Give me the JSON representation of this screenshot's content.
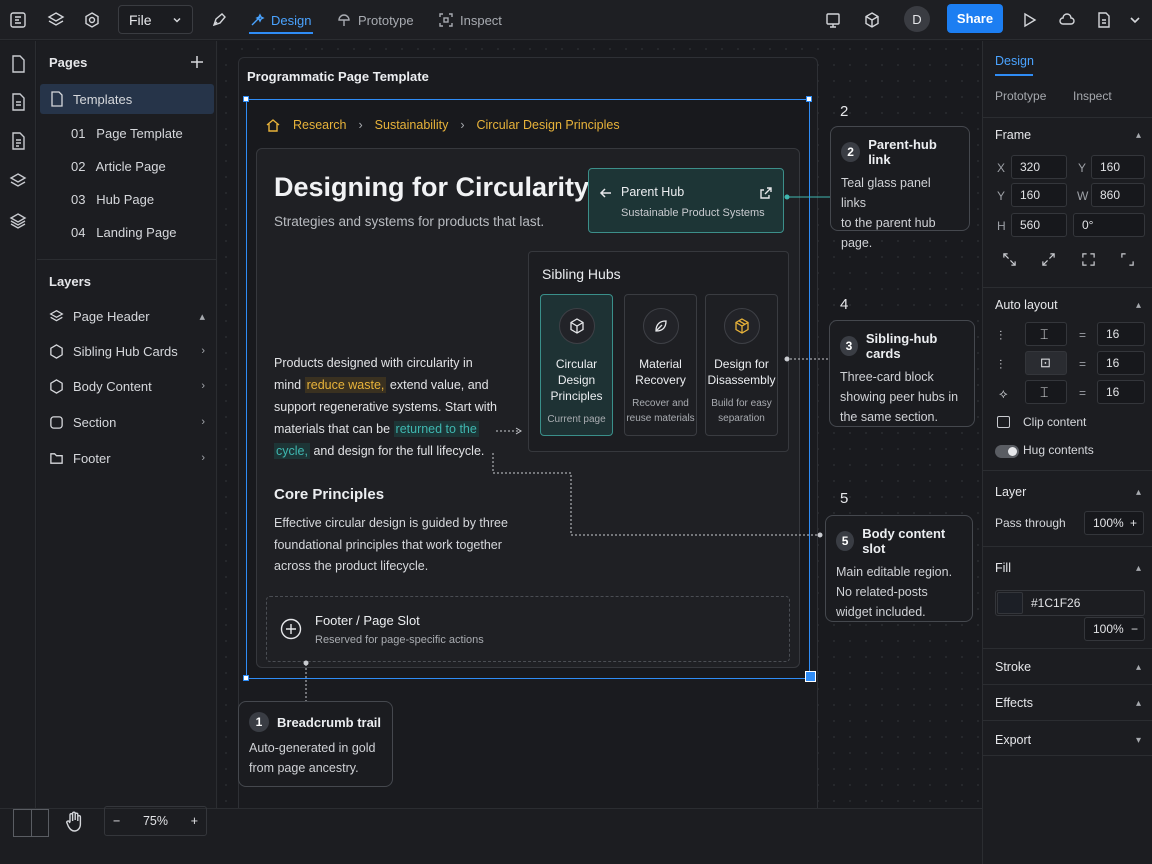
{
  "toolbar": {
    "file_label": "File",
    "tabs": [
      {
        "label": "Design"
      },
      {
        "label": "Prototype"
      },
      {
        "label": "Inspect"
      }
    ],
    "avatar_initial": "D",
    "share_label": "Share"
  },
  "pages": {
    "title": "Pages",
    "items": [
      {
        "label": "Templates"
      },
      {
        "label": "01   Page Template"
      },
      {
        "label": "02   Article Page"
      },
      {
        "label": "03   Hub Page"
      },
      {
        "label": "04   Landing Page"
      }
    ]
  },
  "layers": {
    "title": "Layers",
    "items": [
      {
        "label": "Page Header"
      },
      {
        "label": "Sibling Hub Cards"
      },
      {
        "label": "Body Content"
      },
      {
        "label": "Section"
      },
      {
        "label": "Footer"
      }
    ]
  },
  "zoom": {
    "value": "75%"
  },
  "frame": {
    "title": "Programmatic Page Template",
    "breadcrumb": [
      "Research",
      "Sustainability",
      "Circular Design Principles"
    ],
    "heading": "Designing for Circularity",
    "subheading": "Strategies and systems for products that last.",
    "parent_hub": {
      "label": "Parent Hub",
      "sub": "Sustainable Product Systems"
    },
    "sibling_title": "Sibling Hubs",
    "hubs": [
      {
        "title": "Circular Design Principles",
        "sub": "Current page",
        "icon": "cube-icon"
      },
      {
        "title": "Material Recovery",
        "sub": "Recover and reuse materials",
        "icon": "leaf-icon"
      },
      {
        "title": "Design for Disassembly",
        "sub": "Build for easy separation",
        "icon": "box-icon"
      }
    ],
    "body": {
      "p1": "Products designed with circularity in",
      "p2": "mind",
      "hl1": "reduce waste,",
      "p3": "extend value, and",
      "p4": "support regenerative systems. Start with",
      "p5": "materials that can be",
      "hl2a": "returned to the",
      "hl2b": "cycle,",
      "p6": "and design for the full lifecycle."
    },
    "core_title": "Core Principles",
    "core_lines": [
      "Effective circular design is guided by three",
      "foundational principles that work together",
      "across the product lifecycle."
    ],
    "footer_slot": {
      "title": "Footer / Page Slot",
      "sub": "Reserved for page-specific actions"
    }
  },
  "notes": [
    {
      "num": "1",
      "title": "Breadcrumb trail",
      "lines": [
        "Auto-generated in gold",
        "from page ancestry."
      ]
    },
    {
      "num": "2",
      "title": "Parent-hub link",
      "lines": [
        "Teal glass panel links",
        "to the parent hub",
        "page."
      ]
    },
    {
      "num": "3",
      "title": "Sibling-hub cards",
      "lines": [
        "Three-card block",
        "showing peer hubs in",
        "the same section."
      ]
    },
    {
      "num": "5",
      "title": "Body content slot",
      "lines": [
        "Main editable region.",
        "No related-posts",
        "widget included."
      ]
    }
  ],
  "marker_numbers": [
    "2",
    "4",
    "5"
  ],
  "right_panel": {
    "tabs": [
      "Design",
      "Prototype",
      "Inspect"
    ],
    "frame": {
      "title": "Frame",
      "x1": "320",
      "y1": "160",
      "y2": "160",
      "w": "860",
      "h": "560",
      "rot": "0°",
      "lbl_x": "X",
      "lbl_y": "Y",
      "lbl_y2": "Y",
      "lbl_w": "W",
      "lbl_h": "H"
    },
    "auto_layout": {
      "title": "Auto layout",
      "v1": "16",
      "v2": "16",
      "v3": "16",
      "clip": "Clip content",
      "hug": "Hug contents"
    },
    "layer": {
      "title": "Layer",
      "blend": "Pass through",
      "opacity": "100%"
    },
    "fill": {
      "title": "Fill",
      "hex": "#1C1F26",
      "opacity": "100%",
      "color": "#1C1F26"
    },
    "stroke": {
      "title": "Stroke"
    },
    "effects": {
      "title": "Effects"
    },
    "export": {
      "title": "Export"
    }
  },
  "colors": {
    "accent": "#2f8cf5",
    "gold": "#e8b33a",
    "teal": "#3fb7b0"
  }
}
